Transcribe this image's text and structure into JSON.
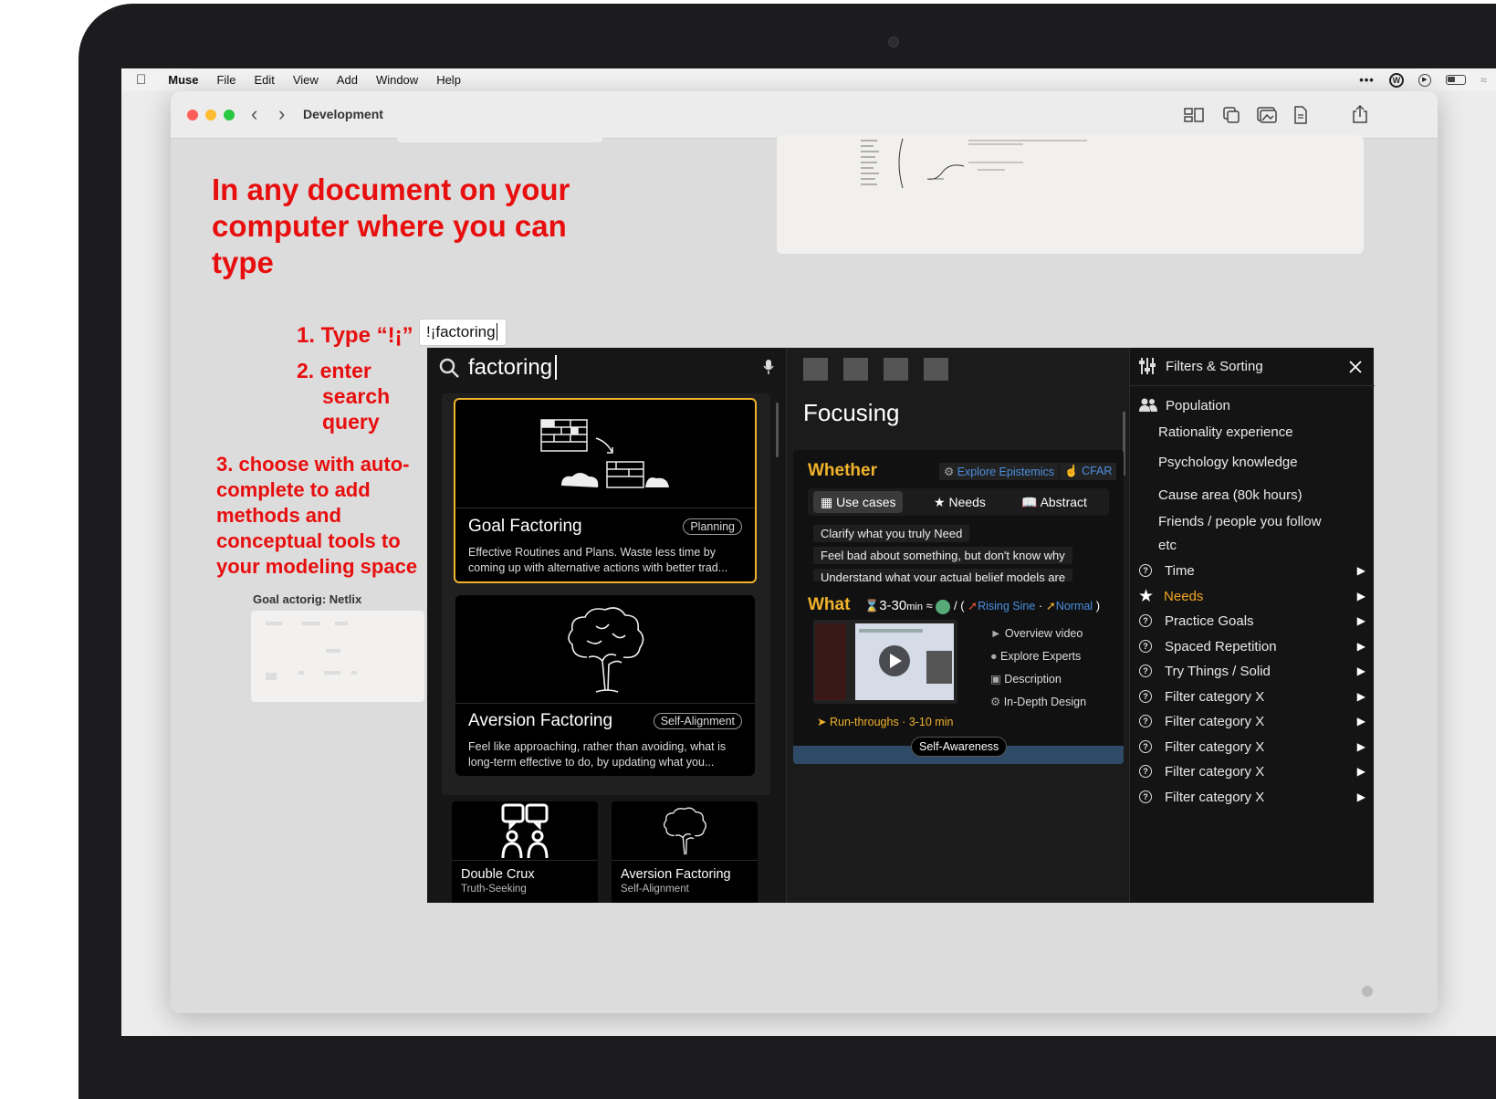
{
  "menubar": {
    "app": "Muse",
    "items": [
      "File",
      "Edit",
      "View",
      "Add",
      "Window",
      "Help"
    ]
  },
  "window": {
    "title": "Development"
  },
  "canvas": {
    "headline": "In any document on your computer where you can type",
    "step1": "1. Type “!¡”",
    "typed_text": "!¡factoring",
    "step2": "2. enter search query",
    "step3": "3. choose with auto-complete to add methods and conceptual tools to your modeling space",
    "thumb_label": "Goal actorig: Netlix"
  },
  "search": {
    "query": "factoring",
    "cards": [
      {
        "title": "Goal Factoring",
        "tag": "Planning",
        "desc": "Effective Routines and Plans. Waste less time by coming up with alternative actions with better trad..."
      },
      {
        "title": "Aversion Factoring",
        "tag": "Self-Alignment",
        "desc": "Feel like approaching, rather than avoiding, what is long-term effective to do, by updating what you..."
      }
    ],
    "small_cards": [
      {
        "title": "Double Crux",
        "sub": "Truth-Seeking"
      },
      {
        "title": "Aversion Factoring",
        "sub": "Self-Alignment"
      }
    ]
  },
  "detail": {
    "title": "Focusing",
    "whether": {
      "label": "Whether",
      "links": [
        "Explore Epistemics",
        "CFAR"
      ],
      "tabs": [
        "Use cases",
        "Needs",
        "Abstract"
      ],
      "use_cases": [
        "Clarify what you truly Need",
        "Feel bad about something, but don't know why",
        "Understand what your actual belief models are"
      ]
    },
    "what": {
      "label": "What",
      "duration": "3-30",
      "unit": "min",
      "approx": "≈",
      "slash": "/ (",
      "rising": "Rising Sine",
      "dot": "·",
      "normal": "Normal",
      "close_paren": ")",
      "resources": [
        "Overview video",
        "Explore Experts",
        "Description",
        "In-Depth Design"
      ],
      "runthroughs": "Run-throughs · 3-10 min"
    },
    "footer_tag": "Self-Awareness"
  },
  "filters": {
    "title": "Filters & Sorting",
    "population_label": "Population",
    "population_items": [
      "Rationality experience",
      "Psychology knowledge",
      "Cause area (80k hours)",
      "Friends / people you follow",
      "etc"
    ],
    "rows": [
      {
        "label": "Time",
        "active": false
      },
      {
        "label": "Needs",
        "active": true
      },
      {
        "label": "Practice Goals",
        "active": false
      },
      {
        "label": "Spaced Repetition",
        "active": false
      },
      {
        "label": "Try Things / Solid",
        "active": false
      },
      {
        "label": "Filter category X",
        "active": false
      },
      {
        "label": "Filter category X",
        "active": false
      },
      {
        "label": "Filter category X",
        "active": false
      },
      {
        "label": "Filter category X",
        "active": false
      },
      {
        "label": "Filter category X",
        "active": false
      }
    ],
    "accent": "#f5a623"
  },
  "colors": {
    "red_text": "#e80e0e",
    "gold": "#f0b32c",
    "blue_link": "#4a8fe0"
  }
}
